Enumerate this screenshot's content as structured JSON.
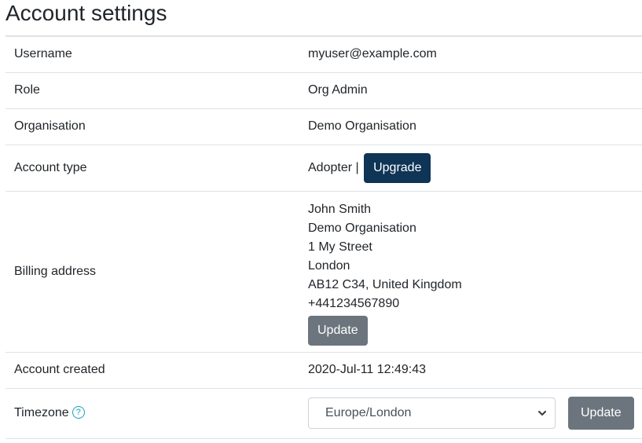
{
  "page": {
    "title": "Account settings"
  },
  "rows": {
    "username": {
      "label": "Username",
      "value": "myuser@example.com"
    },
    "role": {
      "label": "Role",
      "value": "Org Admin"
    },
    "organisation": {
      "label": "Organisation",
      "value": "Demo Organisation"
    },
    "account_type": {
      "label": "Account type",
      "value": "Adopter |",
      "button": "Upgrade"
    },
    "billing": {
      "label": "Billing address",
      "lines": [
        "John Smith",
        "Demo Organisation",
        "1 My Street",
        "London",
        "AB12 C34, United Kingdom",
        "+441234567890"
      ],
      "button": "Update"
    },
    "account_created": {
      "label": "Account created",
      "value": "2020-Jul-11 12:49:43"
    },
    "timezone": {
      "label": "Timezone",
      "help_icon": "question-circle-icon",
      "help_glyph": "?",
      "selected": "Europe/London",
      "button": "Update"
    }
  },
  "colors": {
    "upgrade_button": "#0e3456",
    "secondary_button": "#6c757d",
    "help_icon": "#17a2b8",
    "border": "#dee2e6"
  }
}
